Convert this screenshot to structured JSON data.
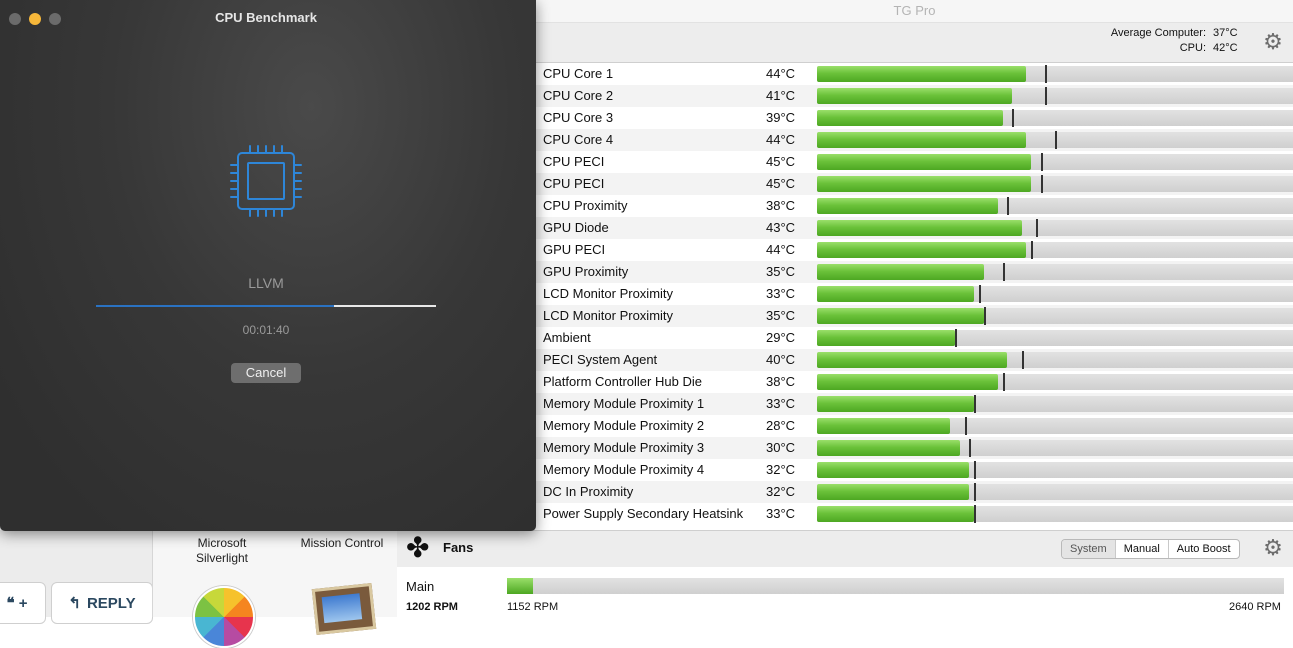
{
  "benchmark": {
    "title": "CPU Benchmark",
    "task": "LLVM",
    "elapsed": "00:01:40",
    "cancel_label": "Cancel",
    "progress": 0.7,
    "accent": "#2a72c2",
    "icon": "cpu-chip-icon"
  },
  "tgpro": {
    "title": "TG Pro",
    "average_label": "Average Computer:",
    "average_value": "37°C",
    "cpu_label": "CPU:",
    "cpu_value": "42°C",
    "scale_min_c": 0,
    "scale_max_c": 100,
    "sensors": [
      {
        "name": "CPU Core 1",
        "temp": "44°C",
        "value": 44,
        "max": 48
      },
      {
        "name": "CPU Core 2",
        "temp": "41°C",
        "value": 41,
        "max": 48
      },
      {
        "name": "CPU Core 3",
        "temp": "39°C",
        "value": 39,
        "max": 41
      },
      {
        "name": "CPU Core 4",
        "temp": "44°C",
        "value": 44,
        "max": 50
      },
      {
        "name": "CPU PECI",
        "temp": "45°C",
        "value": 45,
        "max": 47
      },
      {
        "name": "CPU PECI",
        "temp": "45°C",
        "value": 45,
        "max": 47
      },
      {
        "name": "CPU Proximity",
        "temp": "38°C",
        "value": 38,
        "max": 40
      },
      {
        "name": "GPU Diode",
        "temp": "43°C",
        "value": 43,
        "max": 46
      },
      {
        "name": "GPU PECI",
        "temp": "44°C",
        "value": 44,
        "max": 45
      },
      {
        "name": "GPU Proximity",
        "temp": "35°C",
        "value": 35,
        "max": 39
      },
      {
        "name": "LCD Monitor Proximity",
        "temp": "33°C",
        "value": 33,
        "max": 34
      },
      {
        "name": "LCD Monitor Proximity",
        "temp": "35°C",
        "value": 35,
        "max": 35
      },
      {
        "name": "Ambient",
        "temp": "29°C",
        "value": 29,
        "max": 29
      },
      {
        "name": "PECI System Agent",
        "temp": "40°C",
        "value": 40,
        "max": 43
      },
      {
        "name": "Platform Controller Hub Die",
        "temp": "38°C",
        "value": 38,
        "max": 39
      },
      {
        "name": "Memory Module Proximity 1",
        "temp": "33°C",
        "value": 33,
        "max": 33
      },
      {
        "name": "Memory Module Proximity 2",
        "temp": "28°C",
        "value": 28,
        "max": 31
      },
      {
        "name": "Memory Module Proximity 3",
        "temp": "30°C",
        "value": 30,
        "max": 32
      },
      {
        "name": "Memory Module Proximity 4",
        "temp": "32°C",
        "value": 32,
        "max": 33
      },
      {
        "name": "DC In Proximity",
        "temp": "32°C",
        "value": 32,
        "max": 33
      },
      {
        "name": "Power Supply Secondary Heatsink",
        "temp": "33°C",
        "value": 33,
        "max": 33
      }
    ],
    "bar_color": "#5fbb30",
    "fans": {
      "title": "Fans",
      "modes": [
        "System",
        "Manual",
        "Auto Boost"
      ],
      "active_mode": "System",
      "items": [
        {
          "name": "Main",
          "rpm": "1202 RPM",
          "min": "1152 RPM",
          "max": "2640 RPM",
          "level": 0.034
        }
      ]
    }
  },
  "launchpad": {
    "apps": [
      "Microsoft\nSilverlight",
      "Mission Control"
    ],
    "icons": [
      "photos-icon",
      "preview-icon"
    ]
  },
  "web": {
    "quote_label": "❝ +",
    "reply_label": "REPLY"
  }
}
